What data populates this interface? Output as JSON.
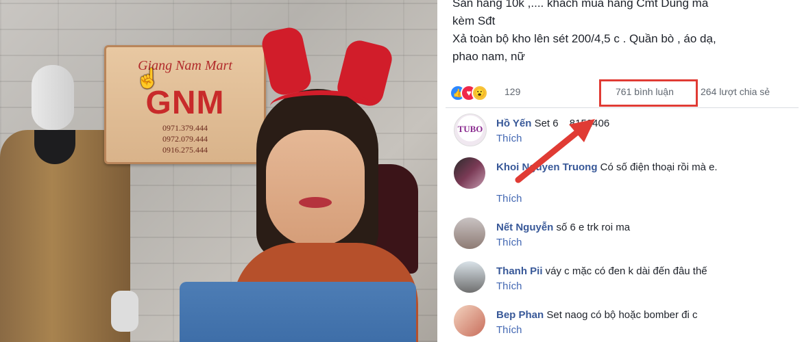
{
  "video": {
    "sign_title": "Giang Nam Mart",
    "sign_logo": "GNM",
    "sign_phones": [
      "0971.379.444",
      "0972.079.444",
      "0916.275.444"
    ]
  },
  "post": {
    "lines": [
      "Sản hàng 10k ,.... khách mua hàng Cmt Dùng mã",
      "kèm Sđt",
      "Xả toàn bộ kho lên sét 200/4,5 c . Quần bò , áo dạ,",
      "phao nam, nữ"
    ]
  },
  "stats": {
    "reactions_count": "129",
    "comments": "761 bình luận",
    "shares": "264 lượt chia sẻ",
    "react_icons": [
      "like-icon",
      "love-icon",
      "wow-icon"
    ]
  },
  "comments": [
    {
      "name": "Hồ Yến",
      "text": "Set 6",
      "text2": "8152406",
      "like": "Thích",
      "avatar_text": "TUBO"
    },
    {
      "name": "Khoi Nguyen Truong",
      "text": "Có số điện thoại rồi mà e.",
      "like": "Thích"
    },
    {
      "name": "Nết Nguyễn",
      "text": "số 6 e trk roi ma",
      "like": "Thích"
    },
    {
      "name": "Thanh Pii",
      "text": "váy c mặc có đen k dài đến đâu thế",
      "like": "Thích"
    },
    {
      "name": "Bep Phan",
      "text": "Set naog có bộ hoặc bomber đi c",
      "like": "Thích"
    }
  ],
  "colors": {
    "highlight": "#e03b34",
    "link": "#385898",
    "arrow": "#e03b34"
  }
}
